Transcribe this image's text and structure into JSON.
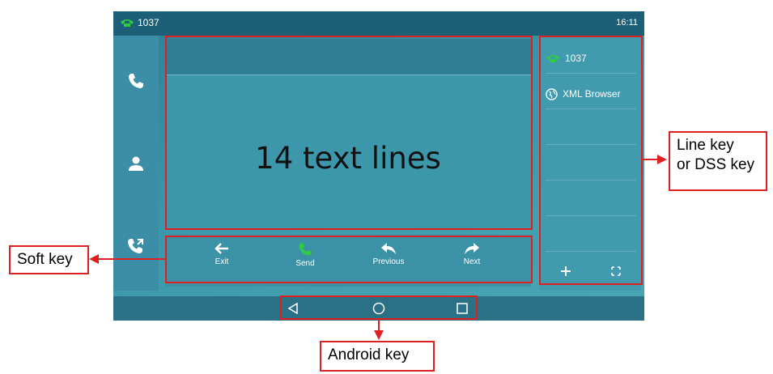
{
  "status_bar": {
    "line_label": "1037",
    "time": "16:11"
  },
  "left_nav": {
    "items": [
      "phone-icon",
      "contact-icon",
      "call-history-icon"
    ]
  },
  "message_area": {
    "content": "14 text lines"
  },
  "softkeys": [
    {
      "label": "Exit",
      "icon": "arrow-left-icon"
    },
    {
      "label": "Send",
      "icon": "phone-icon"
    },
    {
      "label": "Previous",
      "icon": "reply-icon"
    },
    {
      "label": "Next",
      "icon": "forward-icon"
    }
  ],
  "right_panel": {
    "items": [
      {
        "label": "1037",
        "icon": "phone-icon"
      },
      {
        "label": "XML Browser",
        "icon": "globe-icon"
      }
    ],
    "add_icon": "plus-icon",
    "expand_icon": "expand-icon"
  },
  "android_keys": [
    "back-icon",
    "home-icon",
    "recents-icon"
  ],
  "callouts": {
    "soft_key": "Soft key",
    "line_key_line1": "Line key",
    "line_key_line2": "or DSS key",
    "android_key": "Android key"
  },
  "colors": {
    "annotation": "#e02020",
    "line_icon": "#2ecc40"
  }
}
